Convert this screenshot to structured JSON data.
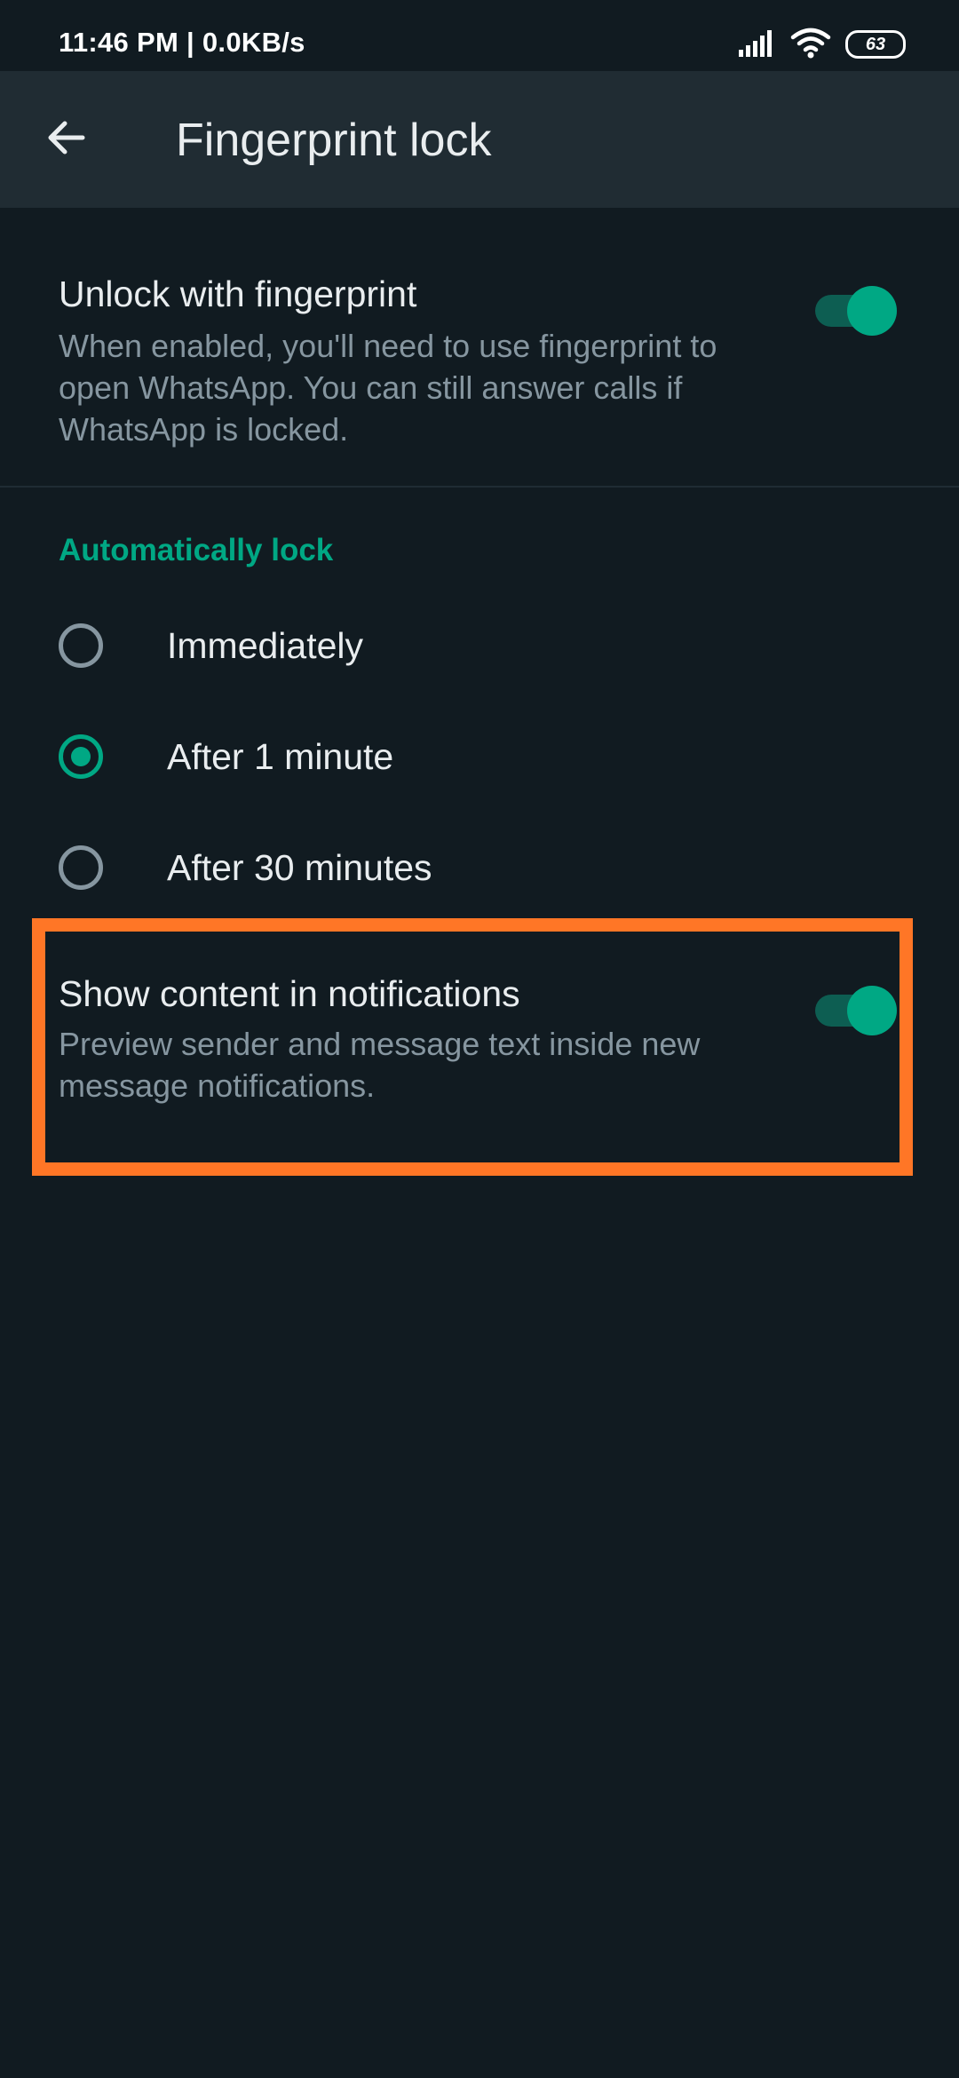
{
  "status_bar": {
    "time_speed": "11:46 PM | 0.0KB/s",
    "battery": "63",
    "icons": [
      "signal-icon",
      "wifi-icon",
      "battery-icon"
    ]
  },
  "app_bar": {
    "title": "Fingerprint lock",
    "back_icon": "arrow-left-icon"
  },
  "unlock_setting": {
    "title": "Unlock with fingerprint",
    "description": "When enabled, you'll need to use fingerprint to open WhatsApp. You can still answer calls if WhatsApp is locked.",
    "enabled": true
  },
  "auto_lock": {
    "header": "Automatically lock",
    "options": [
      {
        "label": "Immediately",
        "selected": false
      },
      {
        "label": "After 1 minute",
        "selected": true
      },
      {
        "label": "After 30 minutes",
        "selected": false
      }
    ]
  },
  "notification_setting": {
    "title": "Show content in notifications",
    "description": "Preview sender and message text inside new message notifications.",
    "enabled": true
  },
  "colors": {
    "background": "#111b21",
    "app_bar": "#202c33",
    "accent": "#00a884",
    "toggle_track": "#0d5e52",
    "secondary_text": "#8696a0",
    "highlight": "#ff7626"
  }
}
